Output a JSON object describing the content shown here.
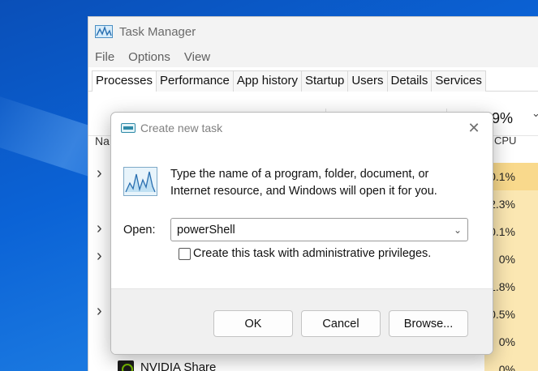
{
  "task_manager": {
    "title": "Task Manager",
    "menu": [
      "File",
      "Options",
      "View"
    ],
    "tabs": [
      "Processes",
      "Performance",
      "App history",
      "Startup",
      "Users",
      "Details",
      "Services"
    ],
    "active_tab": "Processes",
    "columns": {
      "name_label_partial": "Na",
      "cpu_percent": "9%",
      "cpu_label": "CPU"
    },
    "processes": [
      {
        "expandable": true,
        "name": "",
        "cpu": "0.1%"
      },
      {
        "expandable": false,
        "name": "",
        "cpu": "2.3%"
      },
      {
        "expandable": true,
        "name": "",
        "cpu": "0.1%"
      },
      {
        "expandable": true,
        "name": "",
        "cpu": "0%"
      },
      {
        "expandable": false,
        "name": "",
        "cpu": "1.8%"
      },
      {
        "expandable": true,
        "name": "",
        "cpu": "0.5%"
      },
      {
        "expandable": false,
        "name": "",
        "cpu": "0%"
      },
      {
        "expandable": false,
        "name": "NVIDIA Share",
        "cpu": "0%"
      }
    ],
    "highlight_color": "#fbe7b2"
  },
  "dialog": {
    "title": "Create new task",
    "close_glyph": "✕",
    "description_line1": "Type the name of a program, folder, document, or",
    "description_line2": "Internet resource, and Windows will open it for you.",
    "open_label": "Open:",
    "open_value": "powerShell",
    "dropdown_glyph": "⌄",
    "admin_checkbox_label": "Create this task with administrative privileges.",
    "admin_checked": false,
    "buttons": {
      "ok": "OK",
      "cancel": "Cancel",
      "browse": "Browse..."
    }
  },
  "icons": {
    "app": "task-manager-icon",
    "run": "run-dialog-icon",
    "close": "close-icon",
    "dropdown": "chevron-down-icon",
    "expander": "chevron-right-icon",
    "nvidia": "nvidia-icon"
  }
}
